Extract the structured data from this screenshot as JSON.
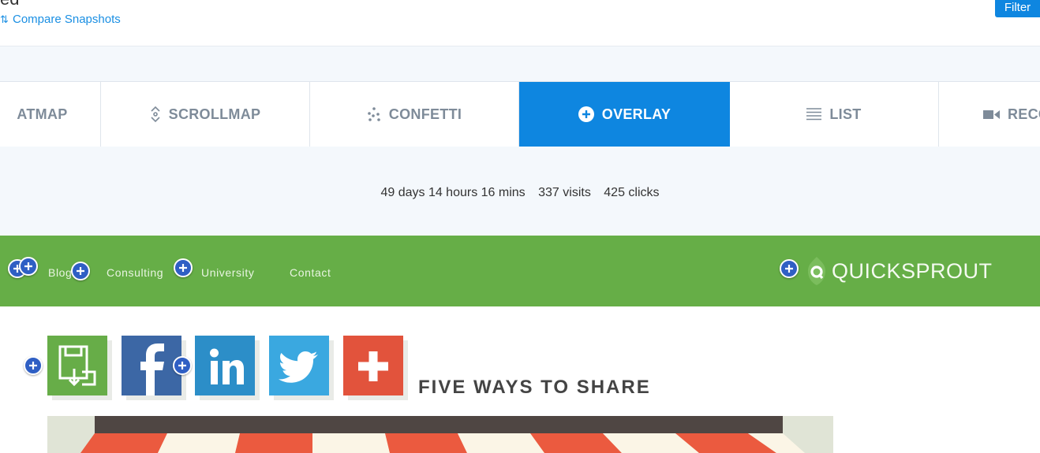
{
  "header": {
    "title_fragment": "ed",
    "compare_label": "Compare Snapshots",
    "filter_label": "Filter"
  },
  "tabs": [
    {
      "label": "ATMAP",
      "icon": "heatmap-icon",
      "active": false
    },
    {
      "label": "SCROLLMAP",
      "icon": "scroll-icon",
      "active": false
    },
    {
      "label": "CONFETTI",
      "icon": "confetti-icon",
      "active": false
    },
    {
      "label": "OVERLAY",
      "icon": "plus-circle-icon",
      "active": true
    },
    {
      "label": "LIST",
      "icon": "list-icon",
      "active": false
    },
    {
      "label": "RECO",
      "icon": "video-icon",
      "active": false
    }
  ],
  "stats": {
    "duration": "49 days 14 hours 16 mins",
    "visits": "337 visits",
    "clicks": "425 clicks"
  },
  "site": {
    "nav_links": [
      "Blog",
      "Consulting",
      "University",
      "Contact"
    ],
    "logo_text": "QUICKSPROUT",
    "share_title": "FIVE WAYS TO SHARE",
    "share_tiles": [
      "save-icon",
      "facebook-icon",
      "linkedin-icon",
      "twitter-icon",
      "plus-icon"
    ]
  },
  "colors": {
    "accent": "#0e86e0",
    "site_green": "#66ae47",
    "marker_blue": "#2f5fc4",
    "tab_text": "#7e8b99"
  }
}
